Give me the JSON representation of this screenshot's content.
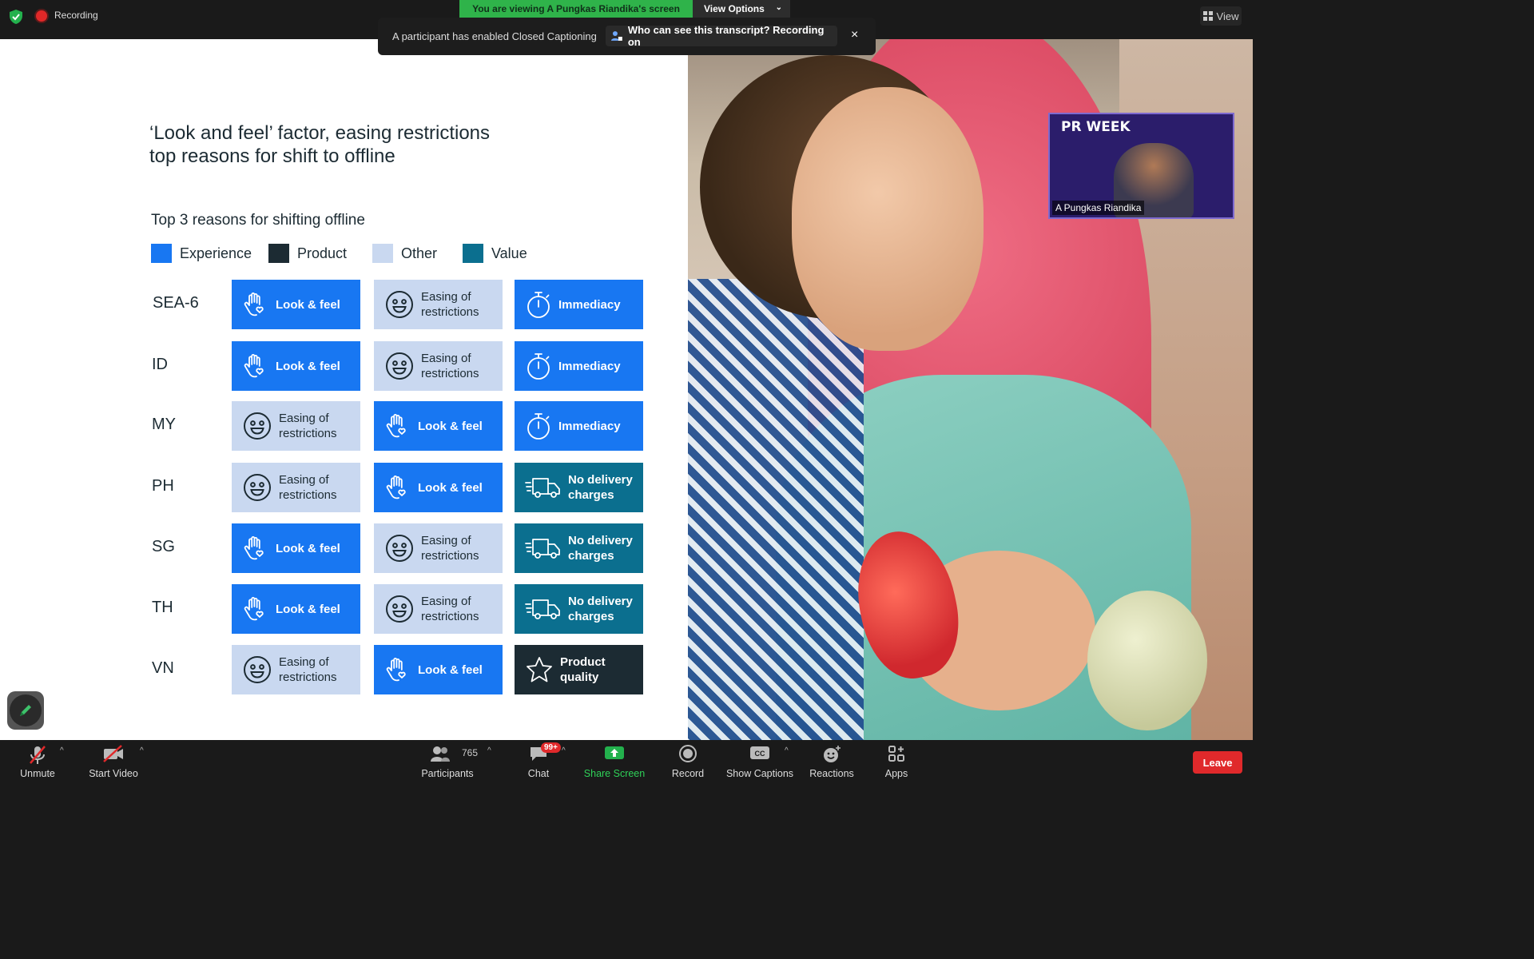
{
  "topbar": {
    "recording_label": "Recording",
    "viewing_banner": "You are viewing A Pungkas Riandika's screen",
    "view_options_label": "View Options",
    "view_label": "View"
  },
  "cc_notice": {
    "message": "A participant has enabled Closed Captioning",
    "question": "Who can see this transcript? Recording on",
    "close": "×"
  },
  "slide": {
    "title": "‘Look and feel’ factor, easing restrictions\ntop reasons for shift to offline",
    "subtitle": "Top 3 reasons for shifting offline",
    "legend": [
      {
        "label": "Experience",
        "color": "#1877f2"
      },
      {
        "label": "Product",
        "color": "#1c2b33"
      },
      {
        "label": "Other",
        "color": "#c9d8f0"
      },
      {
        "label": "Value",
        "color": "#0b6f8f"
      }
    ],
    "rows": [
      {
        "label": "SEA-6",
        "cells": [
          {
            "text": "Look & feel",
            "kind": "exp",
            "icon": "hand-heart-icon"
          },
          {
            "text": "Easing of restrictions",
            "kind": "oth",
            "icon": "smiley-icon"
          },
          {
            "text": "Immediacy",
            "kind": "exp",
            "icon": "stopwatch-icon"
          }
        ]
      },
      {
        "label": "ID",
        "cells": [
          {
            "text": "Look & feel",
            "kind": "exp",
            "icon": "hand-heart-icon"
          },
          {
            "text": "Easing of restrictions",
            "kind": "oth",
            "icon": "smiley-icon"
          },
          {
            "text": "Immediacy",
            "kind": "exp",
            "icon": "stopwatch-icon"
          }
        ]
      },
      {
        "label": "MY",
        "cells": [
          {
            "text": "Easing of restrictions",
            "kind": "oth",
            "icon": "smiley-icon"
          },
          {
            "text": "Look & feel",
            "kind": "exp",
            "icon": "hand-heart-icon"
          },
          {
            "text": "Immediacy",
            "kind": "exp",
            "icon": "stopwatch-icon"
          }
        ]
      },
      {
        "label": "PH",
        "cells": [
          {
            "text": "Easing of restrictions",
            "kind": "oth",
            "icon": "smiley-icon"
          },
          {
            "text": "Look & feel",
            "kind": "exp",
            "icon": "hand-heart-icon"
          },
          {
            "text": "No delivery charges",
            "kind": "val",
            "icon": "delivery-truck-icon"
          }
        ]
      },
      {
        "label": "SG",
        "cells": [
          {
            "text": "Look & feel",
            "kind": "exp",
            "icon": "hand-heart-icon"
          },
          {
            "text": "Easing of restrictions",
            "kind": "oth",
            "icon": "smiley-icon"
          },
          {
            "text": "No delivery charges",
            "kind": "val",
            "icon": "delivery-truck-icon"
          }
        ]
      },
      {
        "label": "TH",
        "cells": [
          {
            "text": "Look & feel",
            "kind": "exp",
            "icon": "hand-heart-icon"
          },
          {
            "text": "Easing of restrictions",
            "kind": "oth",
            "icon": "smiley-icon"
          },
          {
            "text": "No delivery charges",
            "kind": "val",
            "icon": "delivery-truck-icon"
          }
        ]
      },
      {
        "label": "VN",
        "cells": [
          {
            "text": "Easing of restrictions",
            "kind": "oth",
            "icon": "smiley-icon"
          },
          {
            "text": "Look & feel",
            "kind": "exp",
            "icon": "hand-heart-icon"
          },
          {
            "text": "Product quality",
            "kind": "prod",
            "icon": "star-icon"
          }
        ]
      }
    ]
  },
  "video_thumb": {
    "banner": "PR WEEK",
    "name": "A Pungkas Riandika"
  },
  "toolbar": {
    "unmute": "Unmute",
    "start_video": "Start Video",
    "participants": "Participants",
    "participants_count": "765",
    "chat": "Chat",
    "chat_badge": "99+",
    "share_screen": "Share Screen",
    "record": "Record",
    "show_captions": "Show Captions",
    "reactions": "Reactions",
    "apps": "Apps",
    "leave": "Leave"
  }
}
